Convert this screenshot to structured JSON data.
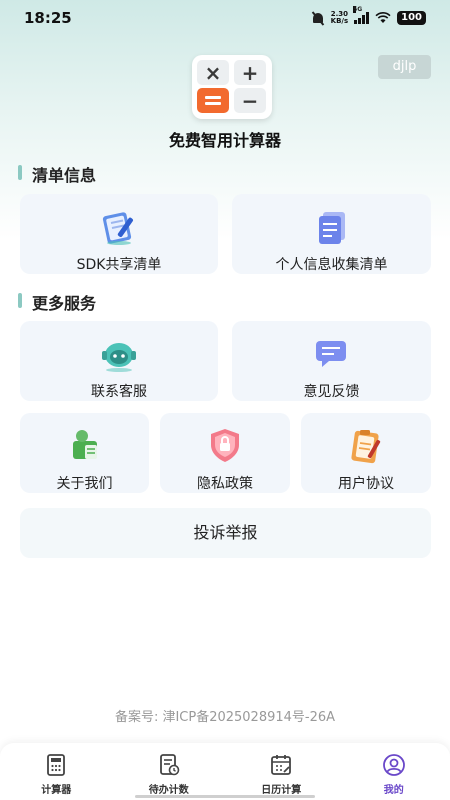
{
  "status_bar": {
    "time": "18:25",
    "net_speed_value": "2.30",
    "net_speed_unit": "KB/s",
    "signal_label": "5G",
    "battery": "100"
  },
  "header": {
    "user_tag": "djlp",
    "app_title": "免费智用计算器"
  },
  "sections": {
    "list_info": {
      "title": "清单信息",
      "items": [
        {
          "label": "SDK共享清单",
          "icon": "notepad-pen-icon"
        },
        {
          "label": "个人信息收集清单",
          "icon": "document-list-icon"
        }
      ]
    },
    "more_services": {
      "title": "更多服务",
      "items": [
        {
          "label": "联系客服",
          "icon": "customer-service-icon"
        },
        {
          "label": "意见反馈",
          "icon": "chat-bubble-icon"
        },
        {
          "label": "关于我们",
          "icon": "person-doc-icon"
        },
        {
          "label": "隐私政策",
          "icon": "shield-lock-icon"
        },
        {
          "label": "用户协议",
          "icon": "clipboard-pen-icon"
        }
      ]
    }
  },
  "complaint": {
    "label": "投诉举报"
  },
  "footer": {
    "icp": "备案号: 津ICP备2025028914号-26A"
  },
  "bottom_nav": {
    "items": [
      {
        "label": "计算器",
        "icon": "calculator-icon"
      },
      {
        "label": "待办计数",
        "icon": "todo-icon"
      },
      {
        "label": "日历计算",
        "icon": "calendar-icon"
      },
      {
        "label": "我的",
        "icon": "profile-icon",
        "active": true
      }
    ]
  },
  "colors": {
    "accent": "#6a48c9",
    "section_marker": "#8cc9c2",
    "card_bg": "#f2f6fb",
    "logo_orange": "#f26a2e"
  }
}
